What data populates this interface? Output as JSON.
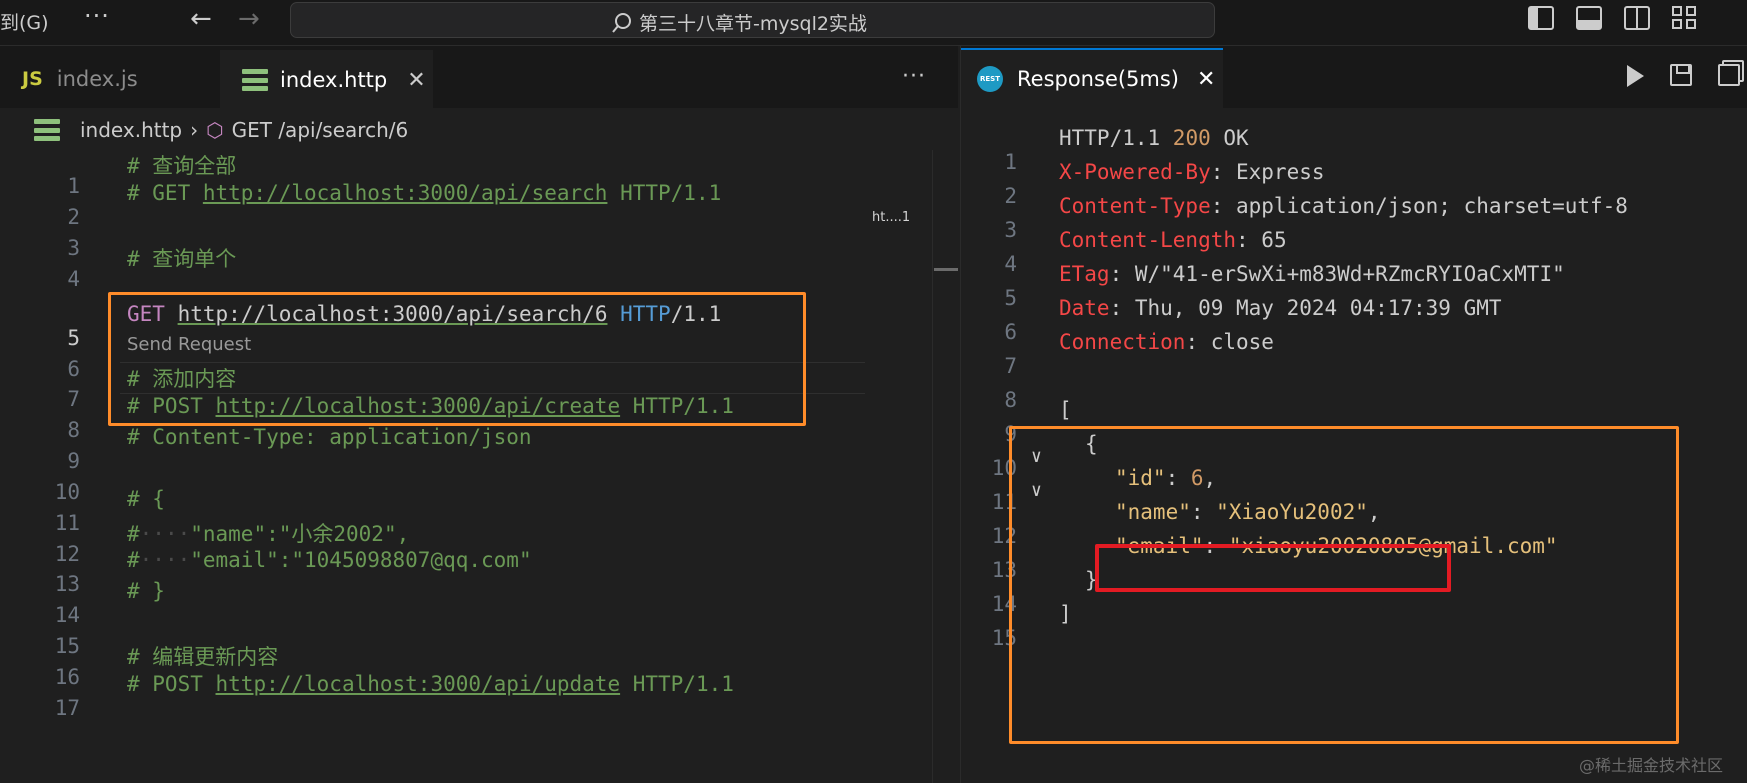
{
  "titlebar": {
    "menu_label": "到(G)",
    "more_label": "···",
    "back_label": "←",
    "forward_label": "→",
    "search_icon": "search-icon",
    "search_text": "第三十八章节-mysql2实战"
  },
  "editor": {
    "tabs": [
      {
        "badge": "JS",
        "label": "index.js"
      },
      {
        "label": "index.http",
        "close": "✕"
      }
    ],
    "more_label": "···",
    "breadcrumb": {
      "file": "index.http",
      "separator": "›",
      "item": "GET /api/search/6"
    },
    "codelens": "Send Request",
    "minimap_label": "ht....1",
    "lines": [
      {
        "n": "1"
      },
      {
        "n": "2"
      },
      {
        "n": "3"
      },
      {
        "n": "4"
      },
      {
        "n": "5"
      },
      {
        "n": "6"
      },
      {
        "n": "7"
      },
      {
        "n": "8"
      },
      {
        "n": "9"
      },
      {
        "n": "10"
      },
      {
        "n": "11"
      },
      {
        "n": "12"
      },
      {
        "n": "13"
      },
      {
        "n": "14"
      },
      {
        "n": "15"
      },
      {
        "n": "16"
      },
      {
        "n": "17"
      }
    ],
    "code": {
      "l1": "# 查询全部",
      "l2_prefix": "# GET ",
      "l2_url": "http://localhost:3000/api/search",
      "l2_suffix": " HTTP/1.1",
      "l4": "# 查询单个",
      "l5_method": "GET",
      "l5_url": "http://localhost:3000/api/search/6",
      "l5_proto": "HTTP",
      "l5_ver": "/1.1",
      "l7": "# 添加内容",
      "l8_prefix": "# POST ",
      "l8_url": "http://localhost:3000/api/create",
      "l8_suffix": " HTTP/1.1",
      "l9": "# Content-Type: application/json",
      "l11": "# {",
      "l12_hash": "#",
      "l12_dots": "····",
      "l12_text": "\"name\":\"小余2002\",",
      "l13_hash": "#",
      "l13_dots": "····",
      "l13_text": "\"email\":\"1045098807@qq.com\"",
      "l14": "# }",
      "l16": "# 编辑更新内容",
      "l17_prefix": "# POST ",
      "l17_url": "http://localhost:3000/api/update",
      "l17_suffix": " HTTP/1.1"
    }
  },
  "response": {
    "tab_icon_text": "REST",
    "tab_label": "Response(5ms)",
    "tab_close": "✕",
    "lines": [
      "1",
      "2",
      "3",
      "4",
      "5",
      "6",
      "7",
      "8",
      "9",
      "10",
      "11",
      "12",
      "13",
      "14",
      "15"
    ],
    "status_proto": "HTTP/1.1 ",
    "status_code": "200",
    "status_text": " OK",
    "headers": [
      {
        "key": "X-Powered-By",
        "value": ": Express"
      },
      {
        "key": "Content-Type",
        "value": ": application/json; charset=utf-8"
      },
      {
        "key": "Content-Length",
        "value": ": 65"
      },
      {
        "key": "ETag",
        "value": ": W/\"41-erSwXi+m83Wd+RZmcRYIOaCxMTI\""
      },
      {
        "key": "Date",
        "value": ": Thu, 09 May 2024 04:17:39 GMT"
      },
      {
        "key": "Connection",
        "value": ": close"
      }
    ],
    "fold_icon": "∨",
    "json": {
      "open_bracket": "[",
      "open_brace": "{",
      "id_key": "\"id\"",
      "id_value": "6",
      "name_key": "\"name\"",
      "name_value": "\"XiaoYu2002\"",
      "email_key": "\"email\"",
      "email_value": "\"xiaoyu20020805@gmail.com\"",
      "close_brace": "}",
      "close_bracket": "]",
      "colon": ": ",
      "comma": ","
    }
  },
  "watermark": "@稀土掘金技术社区",
  "colors": {
    "accent": "#0078d4",
    "highlight_orange": "#ff8c2a",
    "highlight_red": "#e31b23"
  }
}
